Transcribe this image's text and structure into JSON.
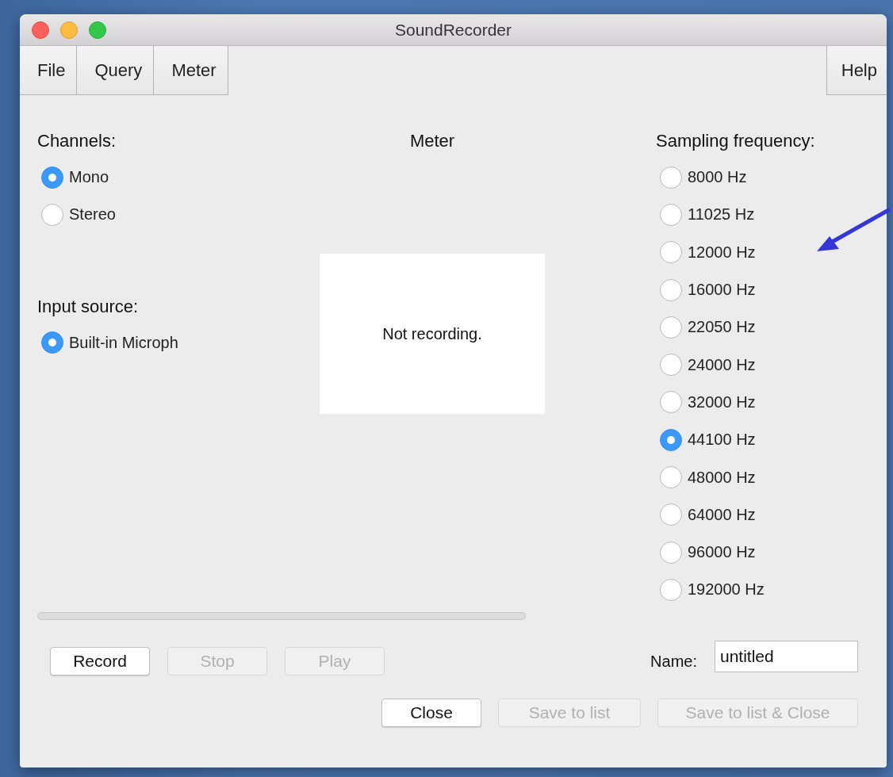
{
  "window": {
    "title": "SoundRecorder"
  },
  "menu": [
    {
      "label": "File"
    },
    {
      "label": "Query"
    },
    {
      "label": "Meter"
    }
  ],
  "help_menu": {
    "label": "Help"
  },
  "channels": {
    "heading": "Channels:",
    "options": [
      {
        "label": "Mono",
        "selected": true
      },
      {
        "label": "Stereo",
        "selected": false
      }
    ]
  },
  "input_source": {
    "heading": "Input source:",
    "options": [
      {
        "label": "Built-in Microph",
        "selected": true
      }
    ]
  },
  "meter": {
    "heading": "Meter",
    "status": "Not recording."
  },
  "sampling_frequency": {
    "heading": "Sampling frequency:",
    "options": [
      {
        "label": "8000 Hz",
        "selected": false
      },
      {
        "label": "11025 Hz",
        "selected": false
      },
      {
        "label": "12000 Hz",
        "selected": false
      },
      {
        "label": "16000 Hz",
        "selected": false
      },
      {
        "label": "22050 Hz",
        "selected": false
      },
      {
        "label": "24000 Hz",
        "selected": false
      },
      {
        "label": "32000 Hz",
        "selected": false
      },
      {
        "label": "44100 Hz",
        "selected": true
      },
      {
        "label": "48000 Hz",
        "selected": false
      },
      {
        "label": "64000 Hz",
        "selected": false
      },
      {
        "label": "96000 Hz",
        "selected": false
      },
      {
        "label": "192000 Hz",
        "selected": false
      }
    ]
  },
  "progress": {
    "level": 0
  },
  "transport_buttons": [
    {
      "label": "Record",
      "disabled": false
    },
    {
      "label": "Stop",
      "disabled": true
    },
    {
      "label": "Play",
      "disabled": true
    }
  ],
  "name_field": {
    "label": "Name:",
    "value": "untitled"
  },
  "action_buttons": [
    {
      "label": "Close",
      "disabled": false
    },
    {
      "label": "Save to list",
      "disabled": true
    },
    {
      "label": "Save to list & Close",
      "disabled": true
    }
  ]
}
